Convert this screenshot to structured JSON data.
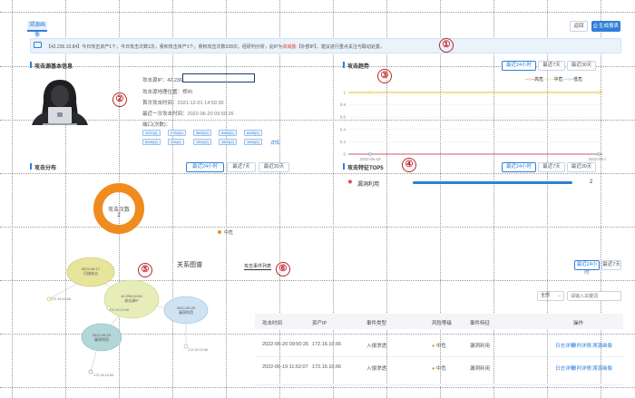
{
  "header": {
    "tab_label": "溯源画像",
    "back_label": "返回",
    "report_label": "生成报表"
  },
  "notice": {
    "text_prefix": "【42.236.10.84】今日攻击资产1个，今日攻击次数1次，累积攻击资产1个，累积攻击次数328次。经研判分析，此IP为",
    "text_highlight": "高威胁",
    "text_mid": "【外部IP】，建议进行重点关注与联动处置。"
  },
  "markers": [
    "①",
    "②",
    "③",
    "④",
    "⑤",
    "⑥"
  ],
  "source_info": {
    "title": "攻击源基本信息",
    "ip_label": "攻击源IP：42.236",
    "location_label": "攻击源地理位置：",
    "location_value": "郑州",
    "first_label": "首次攻击时间：",
    "first_value": "2021-12-01 14:59:30",
    "last_label": "最近一次攻击时间：",
    "last_value": "2022-06-20 09:50:26",
    "ports_label": "端口(次数)：",
    "ports": [
      "1137(4)",
      "2754(2)",
      "3605(3)",
      "5983(2)",
      "6495(2)",
      "6495(3)",
      "105(2)",
      "1504(2)",
      "1605(2)",
      "1605(2)"
    ],
    "more_label": "详情"
  },
  "attack_trend": {
    "title": "攻击趋势",
    "buttons": [
      "最近24小时",
      "最近7天",
      "最近30天"
    ],
    "legend": [
      {
        "name": "高危",
        "color": "#e0453d"
      },
      {
        "name": "中危",
        "color": "#e8c23a"
      },
      {
        "name": "低危",
        "color": "#4a90e2"
      }
    ],
    "yticks": [
      "1",
      "0.8",
      "0.6",
      "0.4",
      "0.2",
      "0"
    ],
    "xlabel_date": "2022-06-19",
    "xlabel_date2": "2022-06-20",
    "series_level": 1
  },
  "distribution": {
    "title": "攻击分布",
    "buttons": [
      "最近24小时",
      "最近7天",
      "最近30天"
    ],
    "center_label": "攻击次数",
    "center_value": "2",
    "legend_label": "中危",
    "legend_color": "#f08c1e"
  },
  "top5": {
    "title": "攻击特征TOP5",
    "buttons": [
      "最近24小时",
      "最近7天",
      "最近30天"
    ],
    "rows": [
      {
        "label": "漏洞利用",
        "value": "2",
        "fraction": 1.0
      }
    ]
  },
  "relation": {
    "title": "关系图谱",
    "link_label": "攻击事件列表",
    "nodes": [
      {
        "l1": "2022-06-17",
        "l2": "扫描攻击"
      },
      {
        "l1": "42.236.10.84",
        "l2": "攻击源IP"
      },
      {
        "l1": "2022-06-20",
        "l2": "漏洞利用"
      },
      {
        "l1": "2022-06-19",
        "l2": "漏洞利用"
      }
    ],
    "leaf_labels": [
      "172.16.10.66",
      "172.16.10.66",
      "172.16.10.66",
      "172.16.10.66"
    ]
  },
  "events": {
    "buttons": [
      "最近24小时",
      "最近7天"
    ],
    "filter_value": "全部",
    "search_placeholder": "请输入关键词",
    "columns": [
      "攻击时间",
      "资产IP",
      "事件类型",
      "风险等级",
      "事件特征",
      "操作"
    ],
    "rows": [
      {
        "time": "2022-06-20 09:50:26",
        "ip": "172.16.10.66",
        "type": "入侵渗透",
        "level": "中危",
        "feature": "漏洞利用",
        "ops": [
          "日志详情",
          "研判详情",
          "溯源画像"
        ]
      },
      {
        "time": "2022-06-19 11:52:07",
        "ip": "172.16.10.66",
        "type": "入侵渗透",
        "level": "中危",
        "feature": "漏洞利用",
        "ops": [
          "日志详情",
          "研判详情",
          "溯源画像"
        ]
      }
    ]
  }
}
